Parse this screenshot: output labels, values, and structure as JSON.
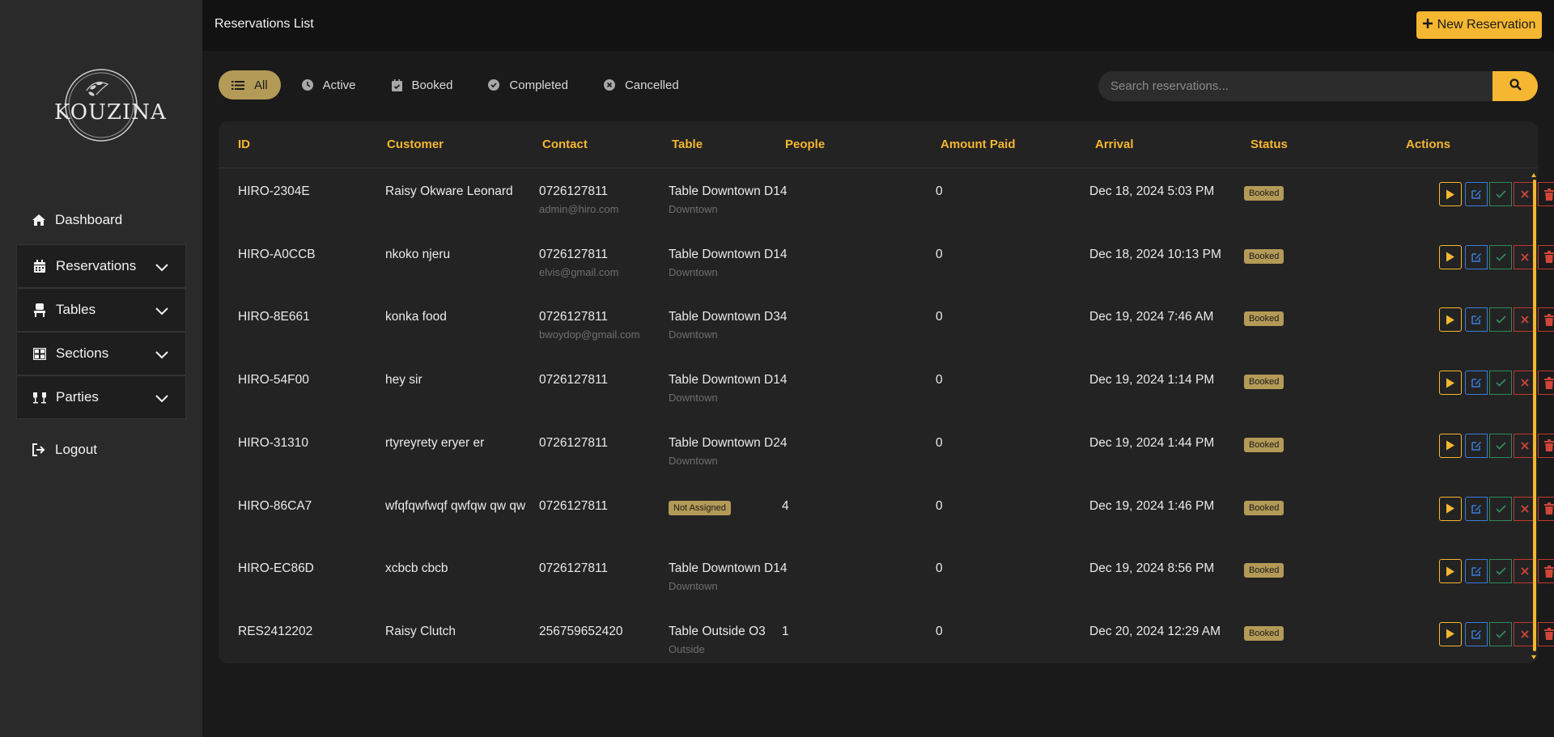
{
  "app": {
    "brand": "KOUZINA",
    "title": "Reservations List",
    "new_button": "New Reservation"
  },
  "sidebar": {
    "items": [
      {
        "label": "Dashboard",
        "icon": "home-icon"
      },
      {
        "label": "Reservations",
        "icon": "calendar-icon"
      },
      {
        "label": "Tables",
        "icon": "chair-icon"
      },
      {
        "label": "Sections",
        "icon": "grid-icon"
      },
      {
        "label": "Parties",
        "icon": "glasses-icon"
      },
      {
        "label": "Logout",
        "icon": "logout-icon"
      }
    ]
  },
  "filters": [
    {
      "label": "All",
      "icon": "list-icon",
      "active": true
    },
    {
      "label": "Active",
      "icon": "clock-icon"
    },
    {
      "label": "Booked",
      "icon": "calendar-check-icon"
    },
    {
      "label": "Completed",
      "icon": "check-circle-icon"
    },
    {
      "label": "Cancelled",
      "icon": "x-circle-icon"
    }
  ],
  "search": {
    "placeholder": "Search reservations..."
  },
  "columns": [
    "ID",
    "Customer",
    "Contact",
    "Table",
    "People",
    "Amount Paid",
    "Arrival",
    "Status",
    "Actions"
  ],
  "rows": [
    {
      "id": "HIRO-2304E",
      "customer": "Raisy Okware Leonard",
      "phone": "0726127811",
      "email": "admin@hiro.com",
      "table": "Table Downtown D14",
      "section": "Downtown",
      "people": "",
      "amount": "0",
      "arrival": "Dec 18, 2024 5:03 PM",
      "status": "Booked"
    },
    {
      "id": "HIRO-A0CCB",
      "customer": "nkoko njeru",
      "phone": "0726127811",
      "email": "elvis@gmail.com",
      "table": "Table Downtown D14",
      "section": "Downtown",
      "people": "",
      "amount": "0",
      "arrival": "Dec 18, 2024 10:13 PM",
      "status": "Booked"
    },
    {
      "id": "HIRO-8E661",
      "customer": "konka food",
      "phone": "0726127811",
      "email": "bwoydop@gmail.com",
      "table": "Table Downtown D34",
      "section": "Downtown",
      "people": "",
      "amount": "0",
      "arrival": "Dec 19, 2024 7:46 AM",
      "status": "Booked"
    },
    {
      "id": "HIRO-54F00",
      "customer": "hey sir",
      "phone": "0726127811",
      "email": "",
      "table": "Table Downtown D14",
      "section": "Downtown",
      "people": "",
      "amount": "0",
      "arrival": "Dec 19, 2024 1:14 PM",
      "status": "Booked"
    },
    {
      "id": "HIRO-31310",
      "customer": "rtyreyrety eryer er",
      "phone": "0726127811",
      "email": "",
      "table": "Table Downtown D24",
      "section": "Downtown",
      "people": "",
      "amount": "0",
      "arrival": "Dec 19, 2024 1:44 PM",
      "status": "Booked"
    },
    {
      "id": "HIRO-86CA7",
      "customer": "wfqfqwfwqf qwfqw qw qw",
      "phone": "0726127811",
      "email": "",
      "table_badge": "Not Assigned",
      "people": "4",
      "amount": "0",
      "arrival": "Dec 19, 2024 1:46 PM",
      "status": "Booked"
    },
    {
      "id": "HIRO-EC86D",
      "customer": "xcbcb cbcb",
      "phone": "0726127811",
      "email": "",
      "table": "Table Downtown D14",
      "section": "Downtown",
      "people": "",
      "amount": "0",
      "arrival": "Dec 19, 2024 8:56 PM",
      "status": "Booked"
    },
    {
      "id": "RES2412202",
      "customer": "Raisy Clutch",
      "phone": "256759652420",
      "email": "",
      "table": "Table Outside O3",
      "section": "Outside",
      "people": "1",
      "amount": "0",
      "arrival": "Dec 20, 2024 12:29 AM",
      "status": "Booked"
    }
  ],
  "actions": [
    "play-icon",
    "edit-icon",
    "check-icon",
    "close-icon",
    "trash-icon"
  ],
  "colors": {
    "accent": "#f5b731",
    "badge": "#b49a57",
    "edit": "#3b7ddd",
    "confirm": "#2f8a5a",
    "danger": "#c0392b"
  }
}
